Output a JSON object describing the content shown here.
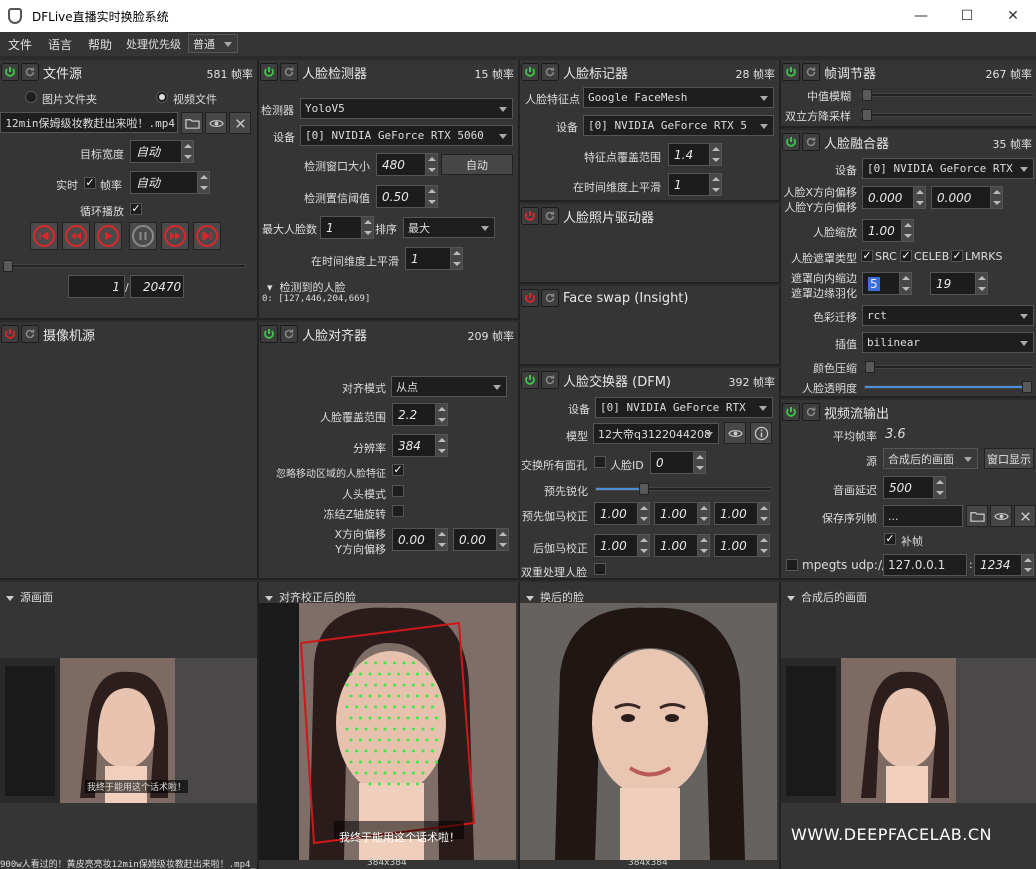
{
  "window": {
    "title": "DFLive直播实时换脸系统"
  },
  "menu": {
    "file": "文件",
    "language": "语言",
    "help": "帮助",
    "priority_label": "处理优先级",
    "priority_value": "普通"
  },
  "file_source": {
    "title": "文件源",
    "fps": "581 帧率",
    "radio_folder": "图片文件夹",
    "radio_video": "视频文件",
    "path": "12min保姆级妆教赶出来啦！.mp4",
    "target_width_label": "目标宽度",
    "target_width": "自动",
    "realtime_label": "实时",
    "fps_label": "帧率",
    "fps_value": "自动",
    "loop_label": "循环播放",
    "frame_current": "1",
    "frame_sep": "/",
    "frame_total": "20470"
  },
  "face_detector": {
    "title": "人脸检测器",
    "fps": "15 帧率",
    "detector_label": "检测器",
    "detector": "YoloV5",
    "device_label": "设备",
    "device": "[0] NVIDIA GeForce RTX 5060",
    "window_label": "检测窗口大小",
    "window": "480",
    "auto_btn": "自动",
    "threshold_label": "检测置信阈值",
    "threshold": "0.50",
    "max_faces_label": "最大人脸数",
    "max_faces": "1",
    "sort_label": "排序",
    "sort": "最大",
    "temporal_label": "在时间维度上平滑",
    "temporal": "1",
    "detected_label": "检测到的人脸",
    "detected_value": "0: [127,446,204,669]"
  },
  "face_marker": {
    "title": "人脸标记器",
    "fps": "28 帧率",
    "landmarks_label": "人脸特征点",
    "landmarks": "Google FaceMesh",
    "device_label": "设备",
    "device": "[0] NVIDIA GeForce RTX 5",
    "coverage_label": "特征点覆盖范围",
    "coverage": "1.4",
    "temporal_label": "在时间维度上平滑",
    "temporal": "1"
  },
  "photo_driver": {
    "title": "人脸照片驱动器"
  },
  "faceswap_insight": {
    "title": "Face swap (Insight)"
  },
  "frame_adjuster": {
    "title": "帧调节器",
    "fps": "267 帧率",
    "median_label": "中值模糊",
    "bicubic_label": "双立方降采样"
  },
  "face_merger": {
    "title": "人脸融合器",
    "fps": "35 帧率",
    "device_label": "设备",
    "device": "[0] NVIDIA GeForce RTX",
    "x_offset_label": "人脸X方向偏移",
    "y_offset_label": "人脸Y方向偏移",
    "x_offset": "0.000",
    "y_offset": "0.000",
    "scale_label": "人脸缩放",
    "scale": "1.00",
    "mask_type_label": "人脸遮罩类型",
    "mask_src": "SRC",
    "mask_celeb": "CELEB",
    "mask_lmrks": "LMRKS",
    "erode_label": "遮罩向内缩边",
    "blur_label": "遮罩边缘羽化",
    "erode": "5",
    "blur": "19",
    "color_transfer_label": "色彩迁移",
    "color_transfer": "rct",
    "interp_label": "插值",
    "interp": "bilinear",
    "color_compress_label": "颜色压缩",
    "opacity_label": "人脸透明度",
    "opacity_value": 0.98
  },
  "camera_source": {
    "title": "摄像机源"
  },
  "face_aligner": {
    "title": "人脸对齐器",
    "fps": "209 帧率",
    "mode_label": "对齐模式",
    "mode": "从点",
    "coverage_label": "人脸覆盖范围",
    "coverage": "2.2",
    "resolution_label": "分辨率",
    "resolution": "384",
    "exclude_moving_label": "忽略移动区域的人脸特征",
    "head_mode_label": "人头模式",
    "freeze_z_label": "冻结Z轴旋转",
    "x_offset_label": "X方向偏移",
    "y_offset_label": "Y方向偏移",
    "x_offset": "0.00",
    "y_offset": "0.00"
  },
  "face_swapper": {
    "title": "人脸交换器 (DFM)",
    "fps": "392 帧率",
    "device_label": "设备",
    "device": "[0] NVIDIA GeForce RTX",
    "model_label": "模型",
    "model": "12大帝q3122044208",
    "swap_all_label": "交换所有面孔",
    "face_id_label": "人脸ID",
    "face_id": "0",
    "presharpen_label": "预先锐化",
    "presharpen_value": 0.28,
    "pre_gamma_label": "预先伽马校正",
    "post_gamma_label": "后伽马校正",
    "gamma_values": [
      "1.00",
      "1.00",
      "1.00"
    ],
    "two_pass_label": "双重处理人脸"
  },
  "stream_output": {
    "title": "视频流输出",
    "avg_fps_label": "平均帧率",
    "avg_fps": "3.6",
    "source_label": "源",
    "source": "合成后的画面",
    "window_btn": "窗口显示",
    "delay_label": "音画延迟",
    "delay": "500",
    "save_path_label": "保存序列帧",
    "save_path": "...",
    "fill_label": "补帧",
    "mpegts_label": "mpegts udp://",
    "ip": "127.0.0.1",
    "port_sep": ":",
    "port": "1234"
  },
  "viewers": {
    "source": "源画面",
    "aligned": "对齐校正后的脸",
    "swapped": "换后的脸",
    "merged": "合成后的画面",
    "aligned_size": "384x384",
    "swapped_size": "384x384",
    "source_caption": "900w人看过的！黄皮亮亮妆12min保姆级妆教赶出来啦！.mp4_",
    "subtitle": "我终于能用这个话术啦！",
    "small_subtitle": "我终于能用这个话术啦！",
    "watermark": "WWW.DEEPFACELAB.CN"
  },
  "colors": {
    "power_on": "#3ec44a",
    "power_off": "#e0242c",
    "accent": "#4a8fd8"
  }
}
